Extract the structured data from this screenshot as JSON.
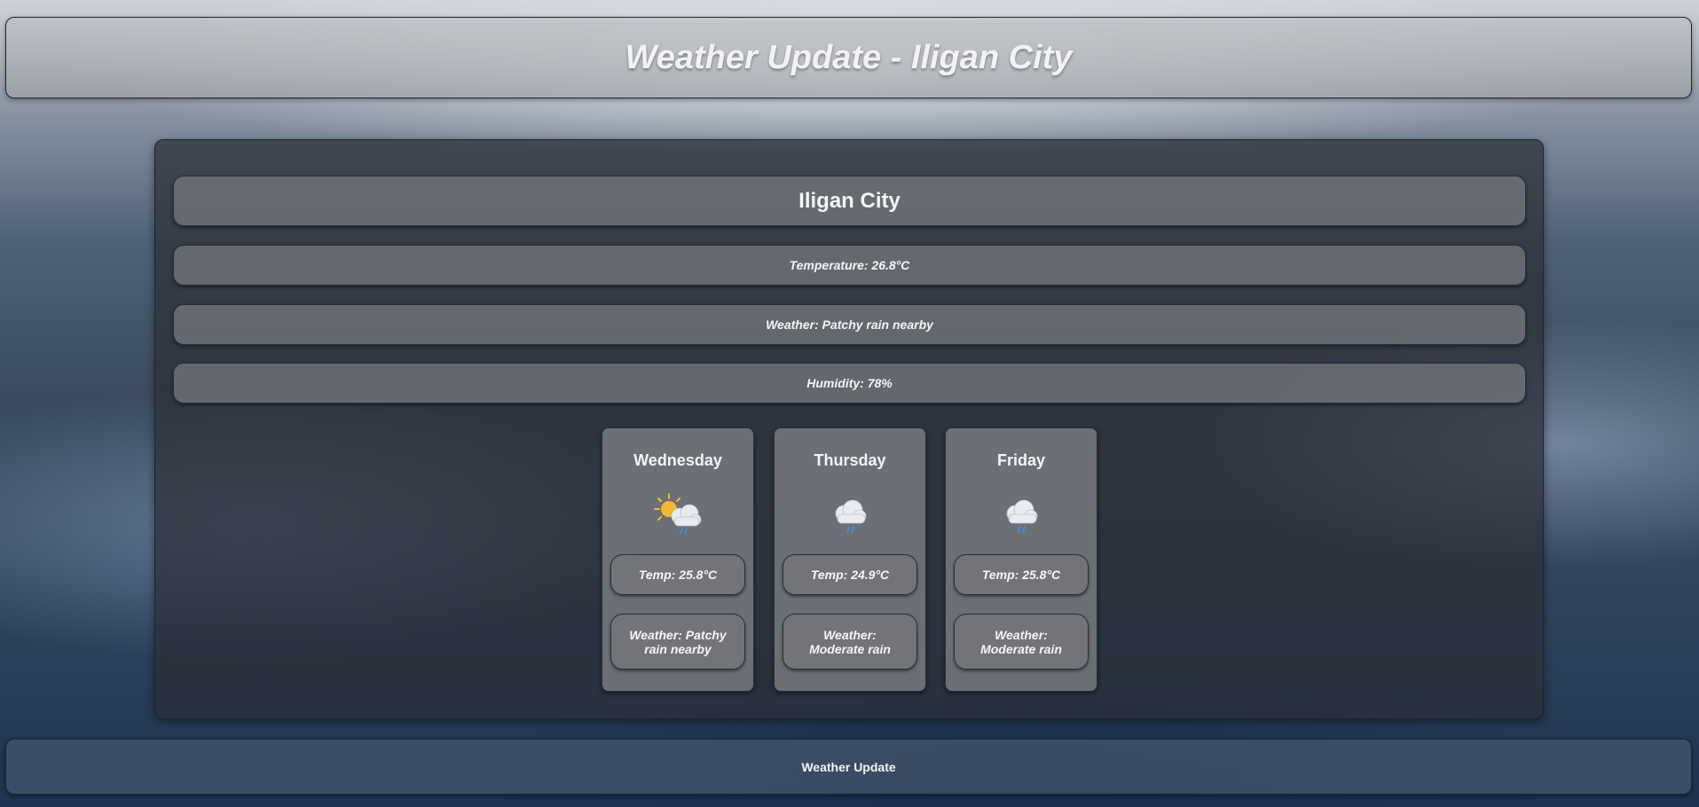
{
  "header": {
    "title": "Weather Update - Iligan City"
  },
  "current": {
    "city": "Iligan City",
    "temperature": "Temperature: 26.8°C",
    "weather": "Weather: Patchy rain nearby",
    "humidity": "Humidity: 78%"
  },
  "forecast": [
    {
      "day": "Wednesday",
      "icon": "partly-sunny-rain-icon",
      "temp": "Temp: 25.8°C",
      "weather": "Weather: Patchy rain nearby"
    },
    {
      "day": "Thursday",
      "icon": "cloud-rain-icon",
      "temp": "Temp: 24.9°C",
      "weather": "Weather: Moderate rain"
    },
    {
      "day": "Friday",
      "icon": "cloud-rain-icon",
      "temp": "Temp: 25.8°C",
      "weather": "Weather: Moderate rain"
    }
  ],
  "footer": {
    "text": "Weather Update"
  },
  "colors": {
    "text": "#f4f4f4",
    "sun": "#f5b82e",
    "cloud": "#e9ecef",
    "rain": "#3b8fd9"
  }
}
